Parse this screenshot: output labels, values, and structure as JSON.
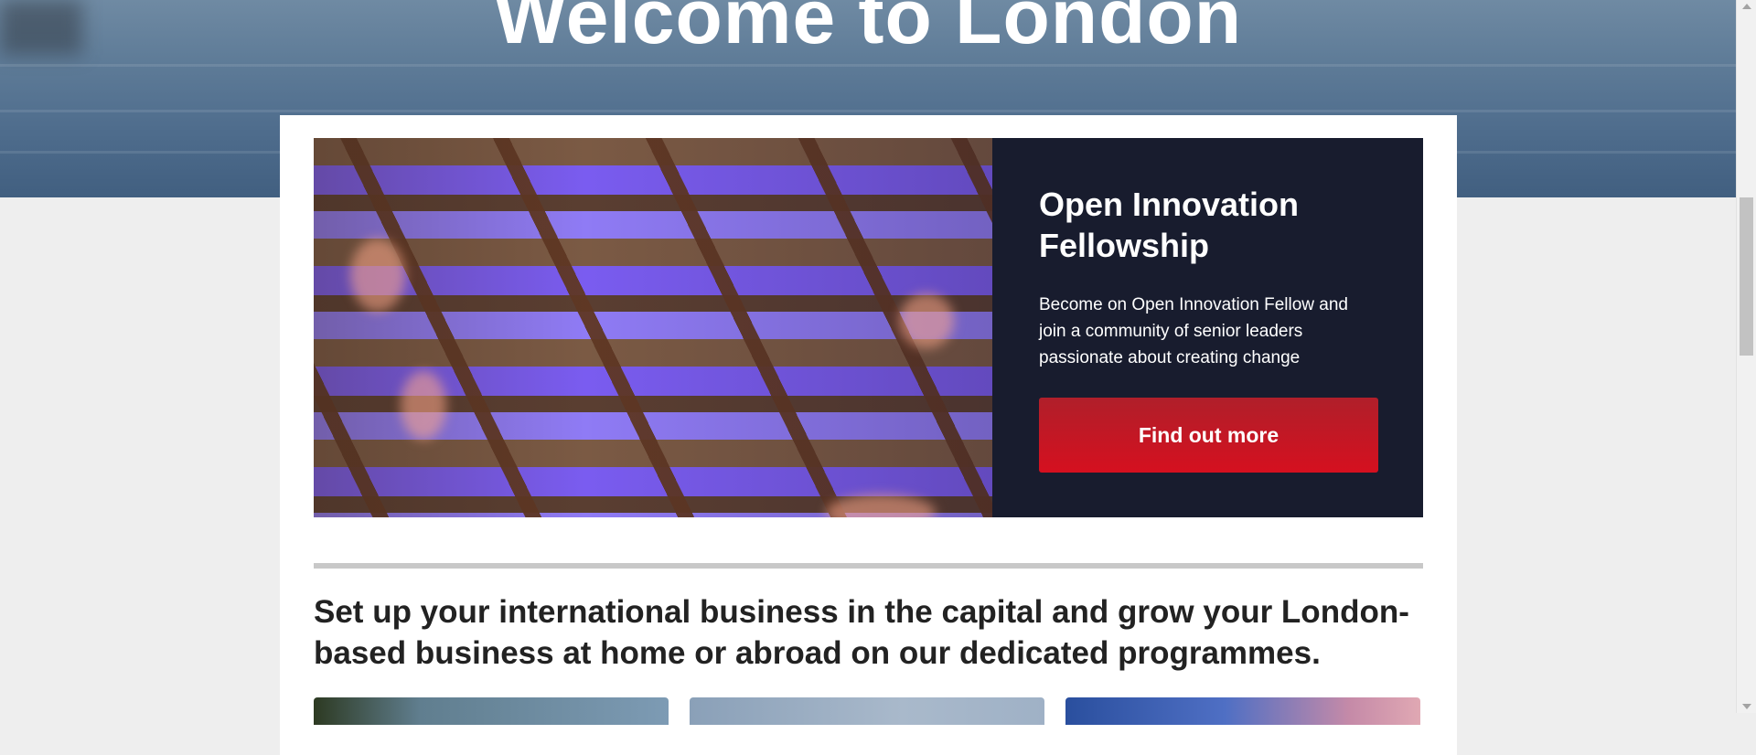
{
  "hero": {
    "title": "Welcome to London"
  },
  "feature": {
    "title": "Open Innovation Fellowship",
    "description": "Become on Open Innovation Fellow and join a community of senior leaders passionate about creating change",
    "button_label": "Find out more",
    "button_color": "#d5101f",
    "panel_color": "#181c2e"
  },
  "intro": {
    "text": "Set up your international business in the capital and grow your London-based business at home or abroad on our dedicated programmes."
  },
  "colors": {
    "page_background": "#eeeeee",
    "content_background": "#ffffff",
    "divider": "#c8c8c8",
    "heading_text": "#222222"
  }
}
